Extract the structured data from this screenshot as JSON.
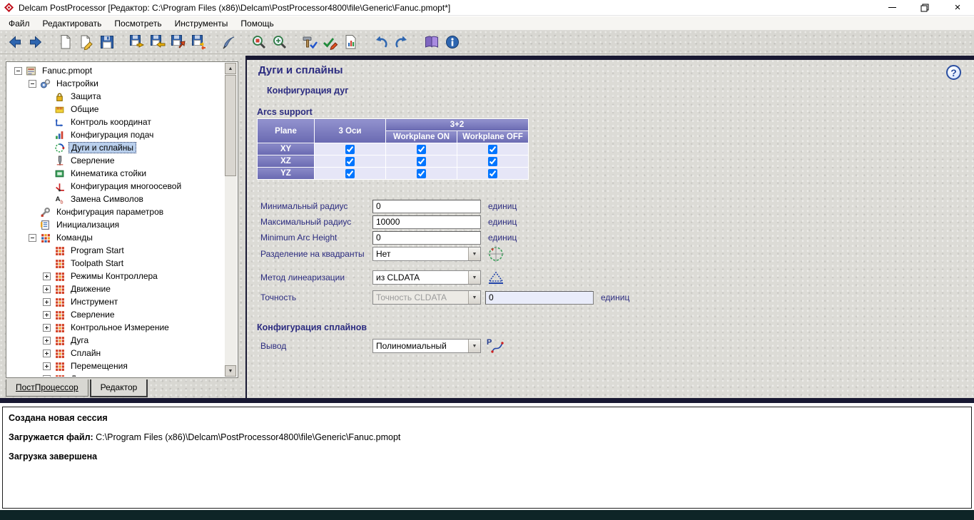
{
  "window": {
    "title": "Delcam PostProcessor [Редактор: C:\\Program Files (x86)\\Delcam\\PostProcessor4800\\file\\Generic\\Fanuc.pmopt*]"
  },
  "glyphs": {
    "chevron_down": "▼",
    "scroll_up": "▲",
    "scroll_down": "▼",
    "close": "×",
    "help": "?"
  },
  "menu": {
    "items": [
      "Файл",
      "Редактировать",
      "Посмотреть",
      "Инструменты",
      "Помощь"
    ]
  },
  "toolbar": {
    "items": [
      "back",
      "forward",
      "|",
      "new-document",
      "document-edit",
      "save-document",
      "|",
      "save-session",
      "import-file",
      "export-file",
      "transfer-file",
      "|",
      "write-file",
      "|",
      "preview-small",
      "preview-large",
      "|",
      "tools-apply",
      "check-edit",
      "report-document",
      "|",
      "undo",
      "redo",
      "|",
      "manual-book",
      "about-info"
    ]
  },
  "tree": {
    "items": [
      {
        "label": "Fanuc.pmopt",
        "depth": 0,
        "expander": "minus",
        "icon": "option-file"
      },
      {
        "label": "Настройки",
        "depth": 1,
        "expander": "minus",
        "icon": "settings"
      },
      {
        "label": "Защита",
        "depth": 2,
        "icon": "protection"
      },
      {
        "label": "Общие",
        "depth": 2,
        "icon": "general"
      },
      {
        "label": "Контроль координат",
        "depth": 2,
        "icon": "coordinates"
      },
      {
        "label": "Конфигурация подач",
        "depth": 2,
        "icon": "feedrate"
      },
      {
        "label": "Дуги и сплайны",
        "depth": 2,
        "icon": "arcs",
        "selected": true
      },
      {
        "label": "Сверление",
        "depth": 2,
        "icon": "drilling"
      },
      {
        "label": "Кинематика стойки",
        "depth": 2,
        "icon": "kinematics"
      },
      {
        "label": "Конфигурация многоосевой",
        "depth": 2,
        "icon": "multiaxis"
      },
      {
        "label": "Замена Символов",
        "depth": 2,
        "icon": "symbols"
      },
      {
        "label": "Конфигурация параметров",
        "depth": 1,
        "icon": "parameters"
      },
      {
        "label": "Инициализация",
        "depth": 1,
        "icon": "initialization"
      },
      {
        "label": "Команды",
        "depth": 1,
        "expander": "minus",
        "icon": "commands"
      },
      {
        "label": "Program Start",
        "depth": 2,
        "icon": "command"
      },
      {
        "label": "Toolpath Start",
        "depth": 2,
        "icon": "command"
      },
      {
        "label": "Режимы Контроллера",
        "depth": 2,
        "expander": "plus",
        "icon": "command"
      },
      {
        "label": "Движение",
        "depth": 2,
        "expander": "plus",
        "icon": "command"
      },
      {
        "label": "Инструмент",
        "depth": 2,
        "expander": "plus",
        "icon": "command"
      },
      {
        "label": "Сверление",
        "depth": 2,
        "expander": "plus",
        "icon": "command"
      },
      {
        "label": "Контрольное Измерение",
        "depth": 2,
        "expander": "plus",
        "icon": "command"
      },
      {
        "label": "Дуга",
        "depth": 2,
        "expander": "plus",
        "icon": "command"
      },
      {
        "label": "Сплайн",
        "depth": 2,
        "expander": "plus",
        "icon": "command"
      },
      {
        "label": "Перемещения",
        "depth": 2,
        "expander": "plus",
        "icon": "command"
      },
      {
        "label": "Другие",
        "depth": 2,
        "expander": "plus",
        "icon": "command"
      }
    ],
    "tabs": [
      {
        "label": "ПостПроцессор",
        "active": false
      },
      {
        "label": "Редактор",
        "active": true
      }
    ]
  },
  "main": {
    "title": "Дуги и сплайны",
    "section_arcs": "Конфигурация дуг",
    "arcs_support": "Arcs support",
    "section_splines": "Конфигурация сплайнов",
    "units": "единиц",
    "table": {
      "col_plane": "Plane",
      "col_3axis": "3 Оси",
      "col_3plus2": "3+2",
      "col_wp_on": "Workplane ON",
      "col_wp_off": "Workplane OFF",
      "rows": [
        {
          "plane": "XY",
          "axis3": true,
          "wp_on": true,
          "wp_off": true
        },
        {
          "plane": "XZ",
          "axis3": true,
          "wp_on": true,
          "wp_off": true
        },
        {
          "plane": "YZ",
          "axis3": true,
          "wp_on": true,
          "wp_off": true
        }
      ]
    },
    "fields": {
      "min_radius": {
        "label": "Минимальный радиус",
        "value": "0"
      },
      "max_radius": {
        "label": "Максимальный радиус",
        "value": "10000"
      },
      "min_arc_height": {
        "label": "Minimum Arc Height",
        "value": "0"
      },
      "quadrant_split": {
        "label": "Разделение на квадранты",
        "value": "Нет"
      },
      "linearization": {
        "label": "Метод линеаризации",
        "value": "из CLDATA"
      },
      "tolerance": {
        "label": "Точность",
        "source": "Точность CLDATA",
        "value": "0"
      },
      "spline_output": {
        "label": "Вывод",
        "value": "Полиномиальный"
      }
    }
  },
  "log": {
    "lines": [
      {
        "bold": "Создана новая сессия",
        "rest": ""
      },
      {
        "bold": "Загружается файл:",
        "rest": " C:\\Program Files (x86)\\Delcam\\PostProcessor4800\\file\\Generic\\Fanuc.pmopt"
      },
      {
        "bold": "Загрузка завершена",
        "rest": ""
      }
    ]
  }
}
